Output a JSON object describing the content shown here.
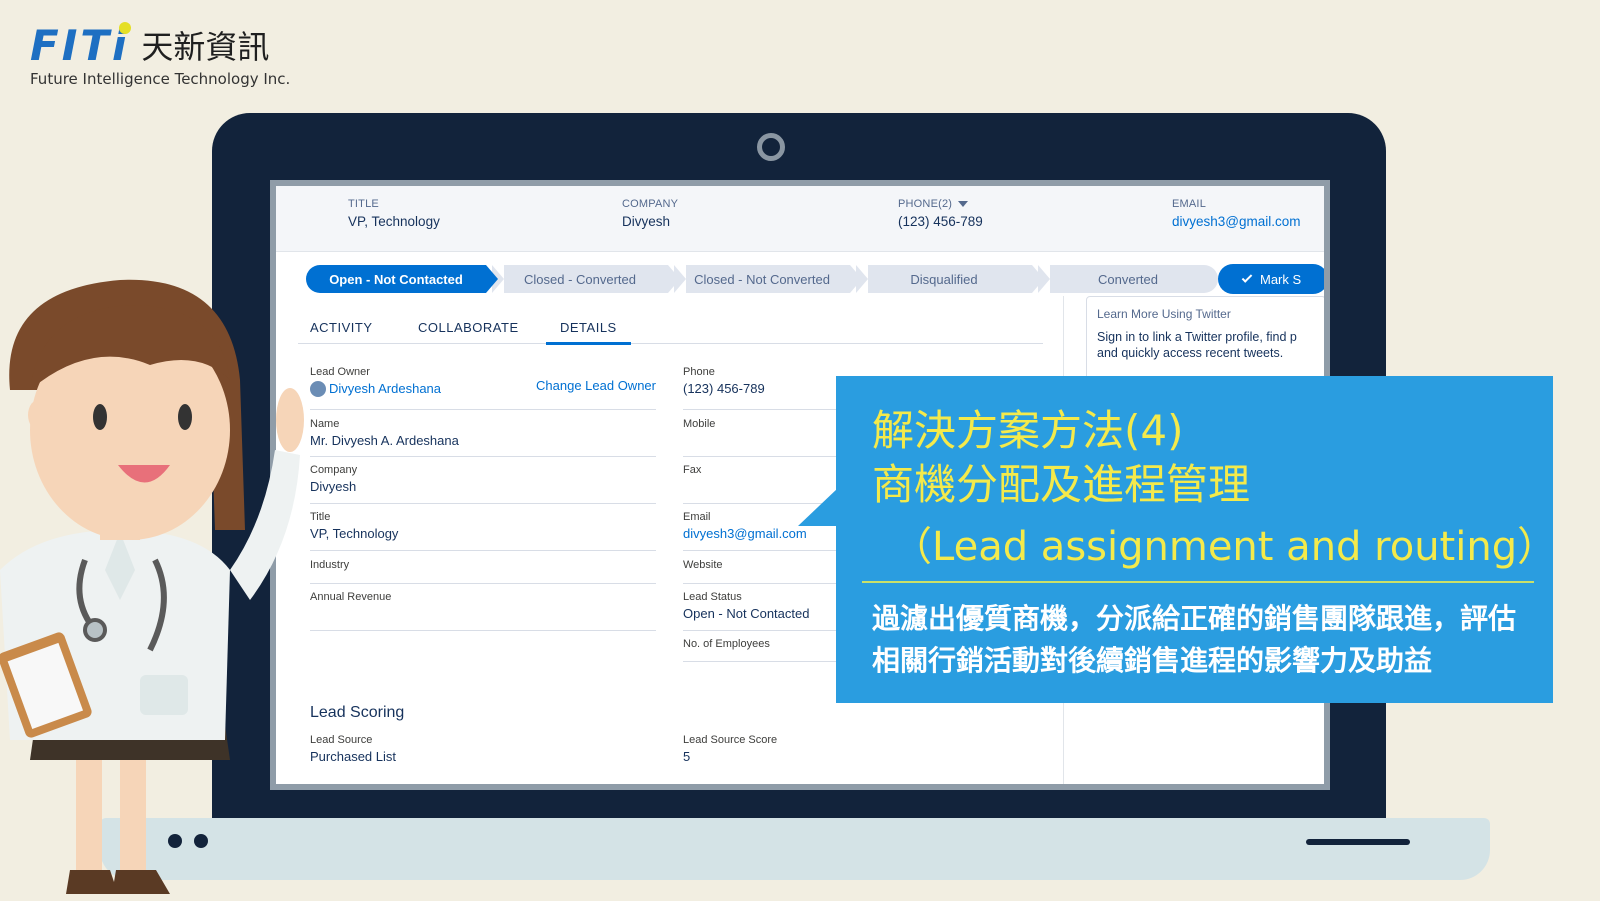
{
  "logo": {
    "mark": "FITi",
    "chinese": "天新資訊",
    "english": "Future Intelligence Technology Inc."
  },
  "record_header": {
    "title_label": "TITLE",
    "title_value": "VP, Technology",
    "company_label": "COMPANY",
    "company_value": "Divyesh",
    "phone_label": "PHONE(2)",
    "phone_value": "(123) 456-789",
    "email_label": "EMAIL",
    "email_value": "divyesh3@gmail.com"
  },
  "path": {
    "steps": [
      "Open - Not Contacted",
      "Closed - Converted",
      "Closed - Not Converted",
      "Disqualified",
      "Converted"
    ],
    "active_index": 0,
    "mark_button": "Mark S"
  },
  "tabs": [
    "ACTIVITY",
    "COLLABORATE",
    "DETAILS"
  ],
  "active_tab": "DETAILS",
  "details": {
    "lead_owner_label": "Lead Owner",
    "lead_owner_value": "Divyesh Ardeshana",
    "change_owner": "Change Lead Owner",
    "name_label": "Name",
    "name_value": "Mr. Divyesh A. Ardeshana",
    "company_label": "Company",
    "company_value": "Divyesh",
    "title_label": "Title",
    "title_value": "VP, Technology",
    "industry_label": "Industry",
    "annual_revenue_label": "Annual Revenue",
    "phone_label": "Phone",
    "phone_value": "(123) 456-789",
    "mobile_label": "Mobile",
    "fax_label": "Fax",
    "email_label": "Email",
    "email_value": "divyesh3@gmail.com",
    "website_label": "Website",
    "lead_status_label": "Lead Status",
    "lead_status_value": "Open - Not Contacted",
    "employees_label": "No. of Employees"
  },
  "lead_scoring": {
    "title": "Lead Scoring",
    "source_label": "Lead Source",
    "source_value": "Purchased List",
    "score_label": "Lead Source Score",
    "score_value": "5"
  },
  "twitter": {
    "title": "Learn More Using Twitter",
    "text": "Sign in to link a Twitter profile, find p and quickly access recent tweets."
  },
  "callout": {
    "title_line1": "解決方案方法(4)",
    "title_line2": "商機分配及進程管理",
    "subtitle": "（Lead assignment and routing）",
    "desc_line1": "過濾出優質商機，分派給正確的銷售團隊跟進，評估",
    "desc_line2": "相關行銷活動對後續銷售進程的影響力及助益"
  },
  "colors": {
    "background": "#f2eee1",
    "laptop": "#12233b",
    "accent": "#0070d2",
    "callout": "#2a9de0",
    "callout_title": "#f4ea4b",
    "logo_blue": "#1e6fc2"
  }
}
